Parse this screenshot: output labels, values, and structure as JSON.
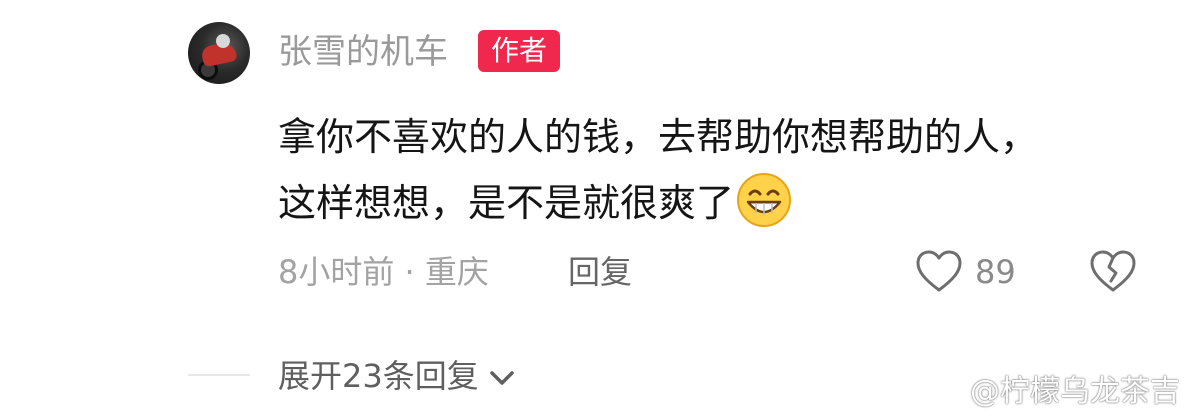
{
  "comment": {
    "username": "张雪的机车",
    "badge": "作者",
    "text_line1": "拿你不喜欢的人的钱，去帮助你想帮助的人，",
    "text_line2": "这样想想，是不是就很爽了",
    "emoji": "grinning-face-icon",
    "time_location": "8小时前 · 重庆",
    "reply_label": "回复",
    "like_count": "89",
    "expand_replies": "展开23条回复"
  },
  "watermark": {
    "text": "@柠檬乌龙茶吉",
    "icon": "weibo-icon"
  },
  "colors": {
    "badge_bg": "#f0284e",
    "text_primary": "#151515",
    "text_secondary": "#9a9a9a"
  }
}
